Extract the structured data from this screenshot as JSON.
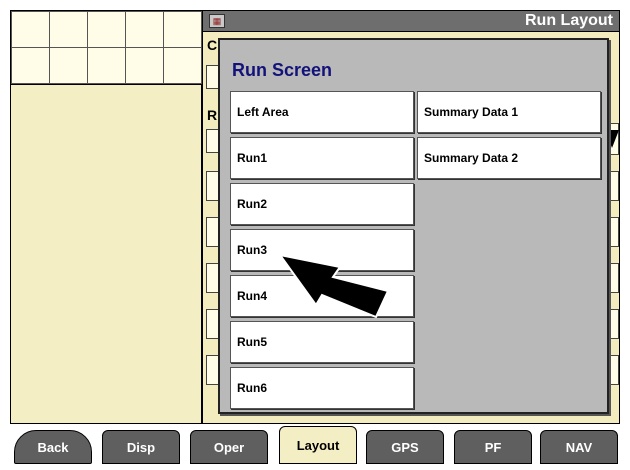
{
  "window": {
    "title": "Run Layout",
    "title_icon": "display-icon"
  },
  "background_fields": {
    "label_1": "C",
    "label_2": "R"
  },
  "modal": {
    "title": "Run Screen",
    "options": [
      "Left Area",
      "Run1",
      "Run2",
      "Run3",
      "Run4",
      "Run5",
      "Run6",
      "Summary Data 1",
      "Summary Data 2"
    ]
  },
  "tabs": [
    "Back",
    "Disp",
    "Oper",
    "Layout",
    "GPS",
    "PF",
    "NAV"
  ],
  "active_tab": "Layout",
  "colors": {
    "modal_title": "#12127a",
    "title_bar": "#6e6e6e",
    "tab_bg": "#5f5f5f",
    "active_tab_bg": "#f4eec4",
    "pane_bg": "#f3ecbe"
  }
}
